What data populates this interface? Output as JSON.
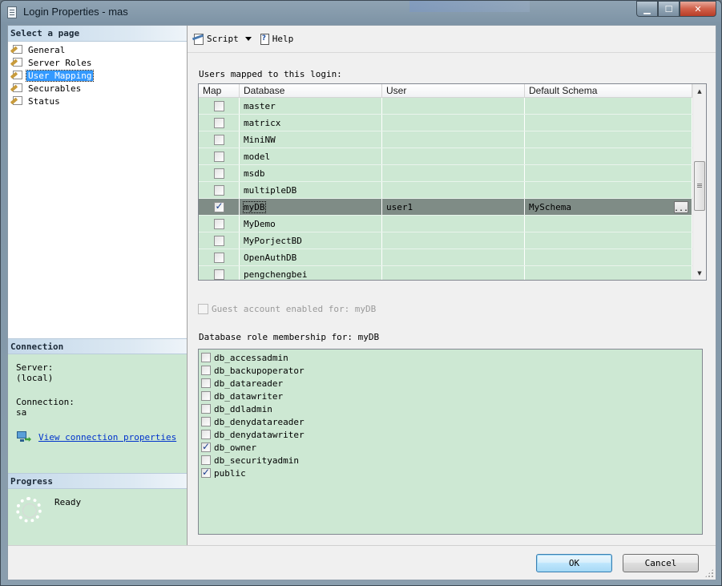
{
  "window": {
    "title": "Login Properties - mas"
  },
  "sidebar": {
    "header": "Select a page",
    "items": [
      {
        "label": "General"
      },
      {
        "label": "Server Roles"
      },
      {
        "label": "User Mapping"
      },
      {
        "label": "Securables"
      },
      {
        "label": "Status"
      }
    ],
    "selected": "User Mapping"
  },
  "connection": {
    "header": "Connection",
    "server_label": "Server:",
    "server_value": "(local)",
    "connection_label": "Connection:",
    "connection_value": "sa",
    "link_label": "View connection properties"
  },
  "progress": {
    "header": "Progress",
    "status": "Ready"
  },
  "toolbar": {
    "script_label": "Script",
    "help_label": "Help"
  },
  "mapping": {
    "label": "Users mapped to this login:",
    "columns": [
      "Map",
      "Database",
      "User",
      "Default Schema"
    ],
    "rows": [
      {
        "checked": false,
        "database": "master",
        "user": "",
        "schema": ""
      },
      {
        "checked": false,
        "database": "matricx",
        "user": "",
        "schema": ""
      },
      {
        "checked": false,
        "database": "MiniNW",
        "user": "",
        "schema": ""
      },
      {
        "checked": false,
        "database": "model",
        "user": "",
        "schema": ""
      },
      {
        "checked": false,
        "database": "msdb",
        "user": "",
        "schema": ""
      },
      {
        "checked": false,
        "database": "multipleDB",
        "user": "",
        "schema": ""
      },
      {
        "checked": true,
        "database": "myDB",
        "user": "user1",
        "schema": "MySchema",
        "selected": true
      },
      {
        "checked": false,
        "database": "MyDemo",
        "user": "",
        "schema": ""
      },
      {
        "checked": false,
        "database": "MyPorjectBD",
        "user": "",
        "schema": ""
      },
      {
        "checked": false,
        "database": "OpenAuthDB",
        "user": "",
        "schema": ""
      },
      {
        "checked": false,
        "database": "pengchengbei",
        "user": "",
        "schema": ""
      }
    ],
    "ellipsis_label": "..."
  },
  "guest": {
    "label": "Guest account enabled for: myDB",
    "enabled": false
  },
  "roles": {
    "label": "Database role membership for: myDB",
    "items": [
      {
        "name": "db_accessadmin",
        "checked": false
      },
      {
        "name": "db_backupoperator",
        "checked": false
      },
      {
        "name": "db_datareader",
        "checked": false
      },
      {
        "name": "db_datawriter",
        "checked": false
      },
      {
        "name": "db_ddladmin",
        "checked": false
      },
      {
        "name": "db_denydatareader",
        "checked": false
      },
      {
        "name": "db_denydatawriter",
        "checked": false
      },
      {
        "name": "db_owner",
        "checked": true
      },
      {
        "name": "db_securityadmin",
        "checked": false
      },
      {
        "name": "public",
        "checked": true
      }
    ]
  },
  "footer": {
    "ok_label": "OK",
    "cancel_label": "Cancel"
  },
  "colors": {
    "panel_green": "#cde8d3",
    "selected_row": "#7f8c86",
    "nav_selected": "#3399ff",
    "link": "#0033cc"
  }
}
